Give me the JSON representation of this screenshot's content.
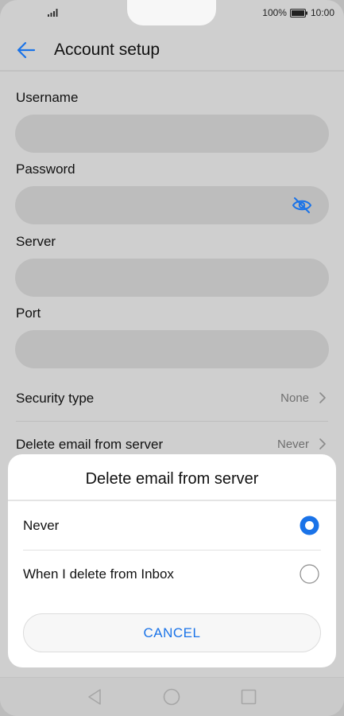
{
  "status_bar": {
    "battery": "100%",
    "time": "10:00"
  },
  "app_bar": {
    "title": "Account setup"
  },
  "form": {
    "username": {
      "label": "Username",
      "value": ""
    },
    "password": {
      "label": "Password",
      "value": ""
    },
    "server": {
      "label": "Server",
      "value": ""
    },
    "port": {
      "label": "Port",
      "value": ""
    }
  },
  "settings": {
    "security_type": {
      "label": "Security type",
      "value": "None"
    },
    "delete_email": {
      "label": "Delete email from server",
      "value": "Never"
    }
  },
  "dialog": {
    "title": "Delete email from server",
    "options": [
      {
        "label": "Never",
        "selected": true
      },
      {
        "label": "When I delete from Inbox",
        "selected": false
      }
    ],
    "cancel_label": "CANCEL"
  },
  "colors": {
    "accent": "#1a73e8",
    "scrim": "#cfcfcf",
    "dialog_bg": "#ffffff"
  },
  "icons": [
    "back-arrow-icon",
    "eye-off-icon",
    "chevron-right-icon",
    "radio-selected-icon",
    "radio-unselected-icon",
    "nav-back-icon",
    "nav-home-icon",
    "nav-recents-icon"
  ]
}
